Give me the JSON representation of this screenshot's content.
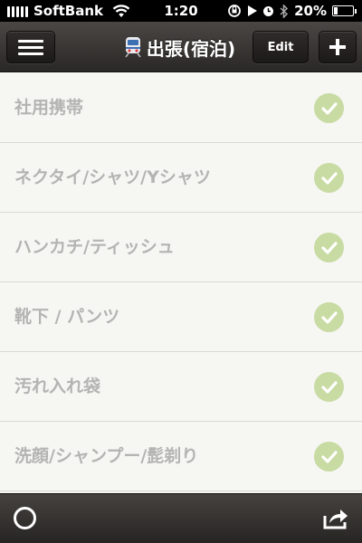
{
  "status_bar": {
    "carrier": "SoftBank",
    "time": "1:20",
    "battery_percent": "20%",
    "battery_level": 0.2
  },
  "nav": {
    "title": "出張(宿泊)",
    "edit_label": "Edit",
    "title_icon": "train-icon",
    "menu_icon": "hamburger-icon",
    "add_icon": "plus-icon"
  },
  "items": [
    {
      "label": "社用携帯",
      "checked": true
    },
    {
      "label": "ネクタイ/シャツ/Yシャツ",
      "checked": true
    },
    {
      "label": "ハンカチ/ティッシュ",
      "checked": true
    },
    {
      "label": "靴下 / パンツ",
      "checked": true
    },
    {
      "label": "汚れ入れ袋",
      "checked": true
    },
    {
      "label": "洗顔/シャンプー/髭剃り",
      "checked": true
    }
  ],
  "toolbar": {
    "left_icon": "circle-icon",
    "right_icon": "share-icon"
  },
  "colors": {
    "check_green": "#c8dba2",
    "item_text": "#b4b4b2",
    "nav_bg": "#3a3735"
  }
}
